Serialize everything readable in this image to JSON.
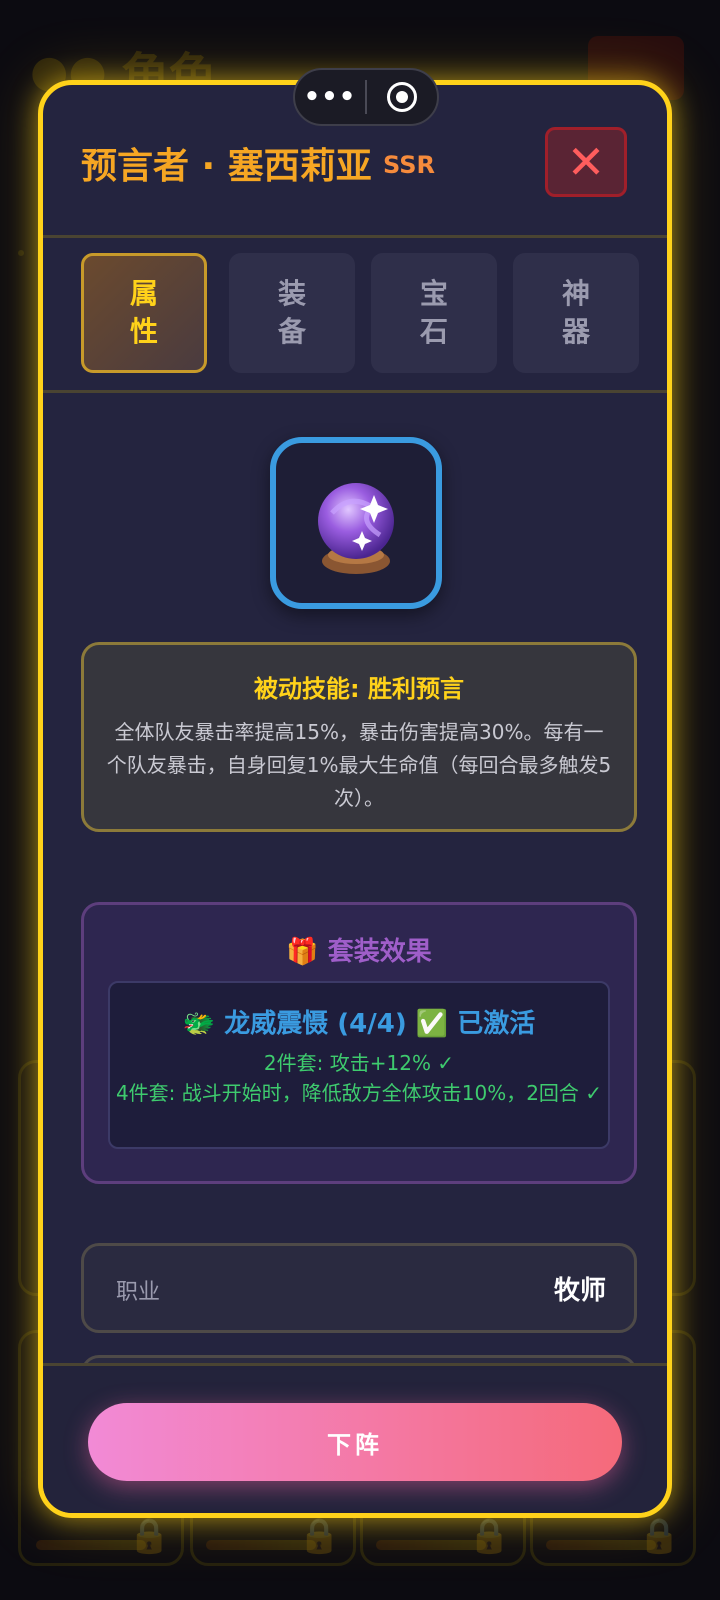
{
  "background": {
    "page_title": "角色"
  },
  "capsule": {
    "more_label": "•••"
  },
  "hero": {
    "name": "预言者 · 塞西莉亚",
    "rarity": "SSR"
  },
  "close_label": "✕",
  "tabs": [
    {
      "line1": "属",
      "line2": "性",
      "active": true
    },
    {
      "line1": "装",
      "line2": "备",
      "active": false
    },
    {
      "line1": "宝",
      "line2": "石",
      "active": false
    },
    {
      "line1": "神",
      "line2": "器",
      "active": false
    }
  ],
  "skill": {
    "title": "被动技能: 胜利预言",
    "description": "全体队友暴击率提高15%，暴击伤害提高30%。每有一个队友暴击，自身回复1%最大生命值（每回合最多触发5次）。"
  },
  "set_bonus": {
    "title": "🎁 套装效果",
    "suit_name": "🐲 龙威震慑 (4/4) ✅ 已激活",
    "bonus_2": "2件套: 攻击+12% ✓",
    "bonus_4": "4件套: 战斗开始时，降低敌方全体攻击10%，2回合 ✓"
  },
  "attributes": {
    "profession_label": "职业",
    "profession_value": "牧师"
  },
  "action_label": "下阵",
  "colors": {
    "modal_border": "#ffd21a",
    "hero_name": "#f6a623",
    "set_title": "#9f5ec9",
    "suit_name": "#3a9be0",
    "bonus_text": "#3ecb6e",
    "button_gradient_start": "#f28ad6",
    "button_gradient_end": "#f56a7a"
  },
  "icons": {
    "hero_avatar": "crystal-ball-icon",
    "close": "close-icon",
    "lock": "lock-icon"
  }
}
